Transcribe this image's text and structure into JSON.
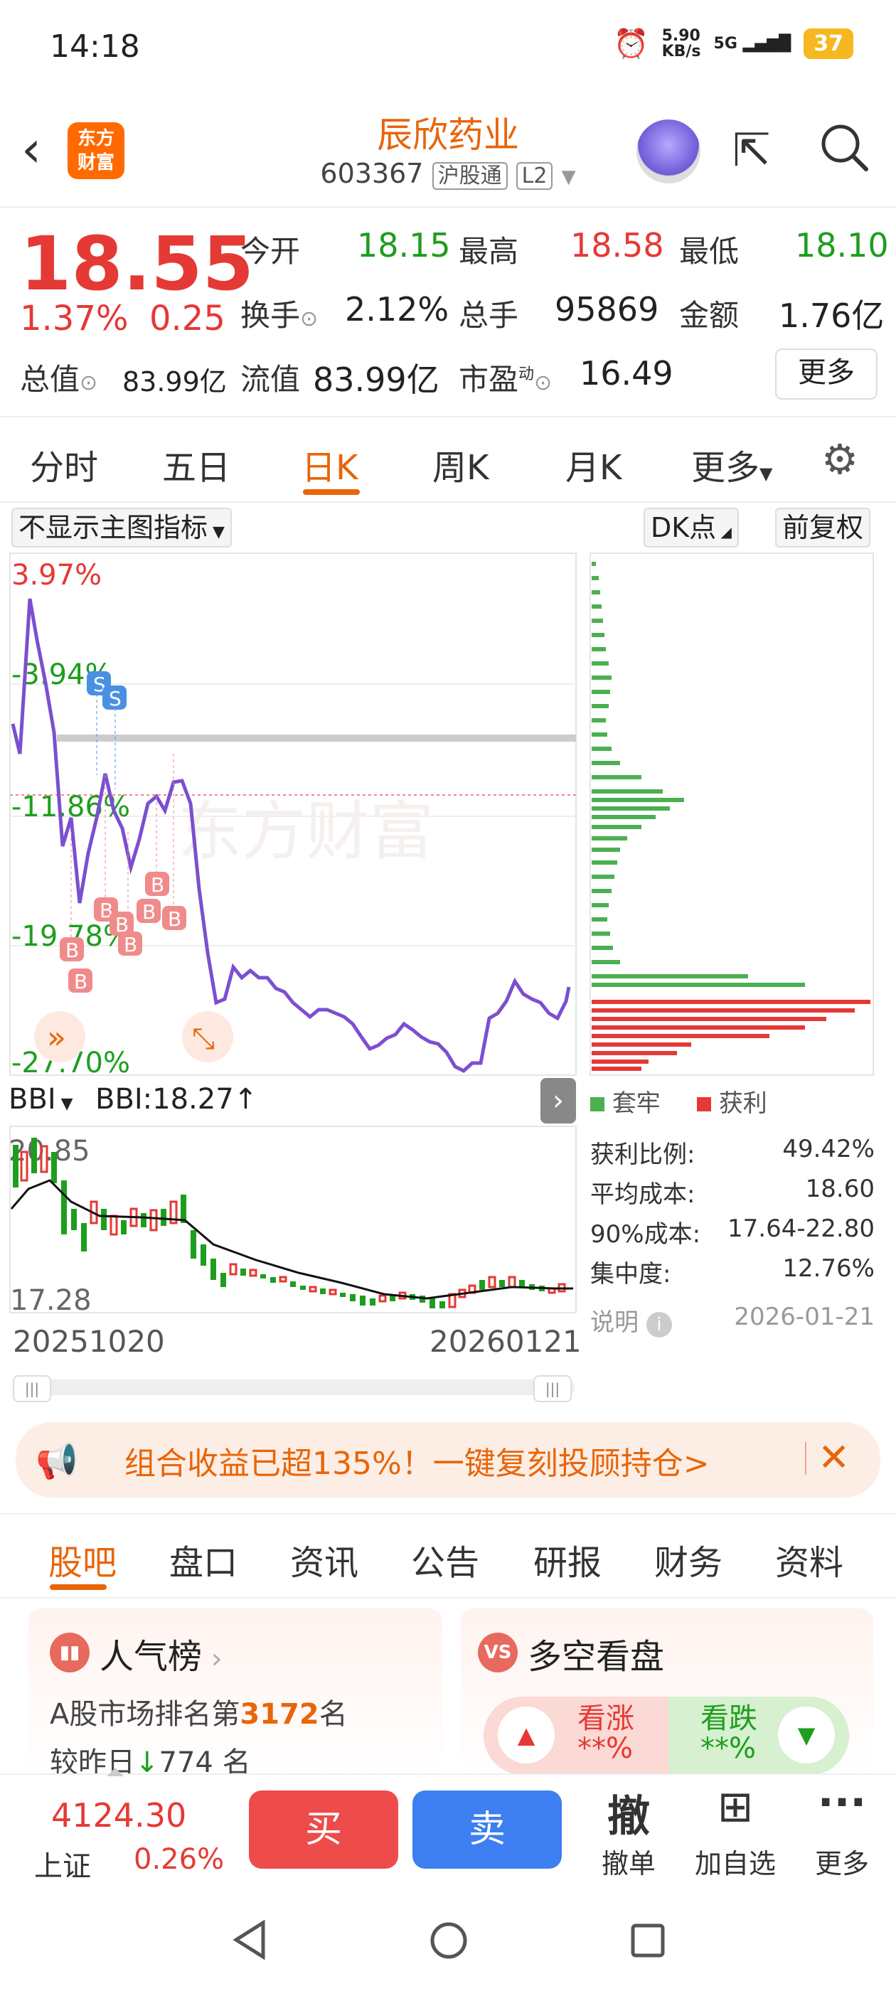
{
  "status_bar": {
    "time": "14:18",
    "net_speed": "5.90",
    "net_unit": "KB/s",
    "signal": "5G",
    "battery": "37"
  },
  "header": {
    "logo_line1": "东方",
    "logo_line2": "财富",
    "title": "辰欣药业",
    "code": "603367",
    "tag1": "沪股通",
    "tag2": "L2"
  },
  "quote": {
    "price": "18.55",
    "change_pct": "1.37%",
    "change": "0.25",
    "open_label": "今开",
    "open": "18.15",
    "high_label": "最高",
    "high": "18.58",
    "low_label": "最低",
    "low": "18.10",
    "turnover_label": "换手",
    "turnover": "2.12%",
    "volume_label": "总手",
    "volume": "95869",
    "amount_label": "金额",
    "amount": "1.76亿",
    "mktcap_label": "总值",
    "mktcap": "83.99亿",
    "float_label": "流值",
    "float": "83.99亿",
    "pe_label": "市盈",
    "pe_sup": "动",
    "pe": "16.49",
    "more": "更多"
  },
  "tabs": [
    "分时",
    "五日",
    "日K",
    "周K",
    "月K",
    "更多"
  ],
  "chart": {
    "indicator_select": "不显示主图指标",
    "dk_label": "DK点",
    "adjust_label": "前复权",
    "y_labels": [
      "3.97%",
      "-3.94%",
      "-11.86%",
      "-19.78%",
      "-27.70%"
    ],
    "bbi_select": "BBI",
    "bbi_value": "BBI:18.27↑",
    "bbi_high": "20.85",
    "bbi_low": "17.28",
    "date_start": "20251020",
    "date_end": "20260121",
    "markers_s": [
      "S",
      "S"
    ],
    "markers_b": [
      "B",
      "B",
      "B",
      "B",
      "B",
      "B",
      "B",
      "B"
    ]
  },
  "chip": {
    "legend_trapped": "套牢",
    "legend_profit": "获利",
    "rows": [
      {
        "label": "获利比例:",
        "value": "49.42%"
      },
      {
        "label": "平均成本:",
        "value": "18.60"
      },
      {
        "label": "90%成本:",
        "value": "17.64-22.80"
      },
      {
        "label": "集中度:",
        "value": "12.76%"
      }
    ],
    "note_label": "说明",
    "date": "2026-01-21"
  },
  "banner": {
    "text": "组合收益已超135%！一键复刻投顾持仓>"
  },
  "bottom_tabs": [
    "股吧",
    "盘口",
    "资讯",
    "公告",
    "研报",
    "财务",
    "资料"
  ],
  "cards": {
    "popularity": {
      "title": "人气榜",
      "line1_prefix": "A股市场排名第",
      "rank": "3172",
      "line1_suffix": "名",
      "line2_prefix": "较昨日",
      "change": "774",
      "line2_suffix": "名"
    },
    "longshort": {
      "title": "多空看盘",
      "up_label": "看涨",
      "up_value": "**%",
      "down_label": "看跌",
      "down_value": "**%"
    }
  },
  "bottom_bar": {
    "index_value": "4124.30",
    "index_name": "上证",
    "index_pct": "0.26%",
    "buy": "买",
    "sell": "卖",
    "cancel_icon": "撤",
    "cancel": "撤单",
    "add": "加自选",
    "more": "更多"
  },
  "colors": {
    "accent": "#e8650a",
    "up": "#e53935",
    "down": "#1e9e1e",
    "purple_line": "#7b4fd0"
  }
}
